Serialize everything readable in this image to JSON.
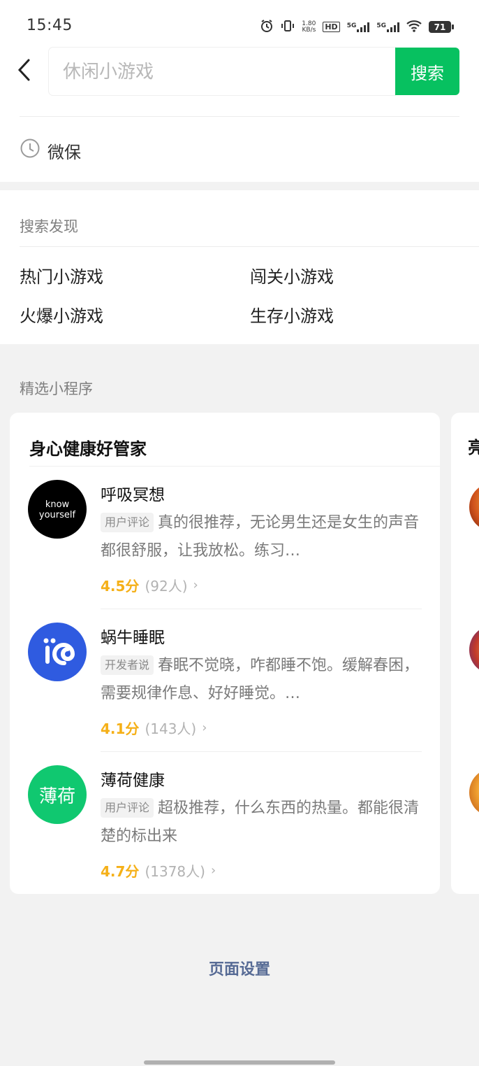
{
  "status_bar": {
    "time": "15:45",
    "net_speed_value": "1.80",
    "net_speed_unit": "KB/s",
    "hd": "HD",
    "sim1": "5G",
    "sim2": "5G",
    "battery": "71"
  },
  "search": {
    "placeholder": "休闲小游戏",
    "button_label": "搜索"
  },
  "history": {
    "items": [
      {
        "label": "微保",
        "icon": "clock-icon"
      }
    ]
  },
  "discover": {
    "title": "搜索发现",
    "items": [
      "热门小游戏",
      "闯关小游戏",
      "火爆小游戏",
      "生存小游戏"
    ]
  },
  "featured": {
    "title": "精选小程序",
    "card": {
      "title": "身心健康好管家",
      "apps": [
        {
          "name": "呼吸冥想",
          "logo_text": "know yourself",
          "logo_color": "#000000",
          "tag": "用户评论",
          "desc": "真的很推荐，无论男生还是女生的声音都很舒服，让我放松。练习…",
          "score": "4.5分",
          "count": "(92人)"
        },
        {
          "name": "蜗牛睡眠",
          "logo_text": "io",
          "logo_color": "#2f5be0",
          "tag": "开发者说",
          "desc": "春眠不觉晓，咋都睡不饱。缓解春困，需要规律作息、好好睡觉。…",
          "score": "4.1分",
          "count": "(143人)"
        },
        {
          "name": "薄荷健康",
          "logo_text": "薄荷",
          "logo_color": "#10c870",
          "tag": "用户评论",
          "desc": "超极推荐，什么东西的热量。都能很清楚的标出来",
          "score": "4.7分",
          "count": "(1378人)"
        }
      ]
    },
    "next_card_title_partial": "亮"
  },
  "footer": {
    "page_settings": "页面设置"
  },
  "colors": {
    "accent_green": "#07c160",
    "link_blue": "#576b95",
    "rating_gold": "#f5b018"
  }
}
